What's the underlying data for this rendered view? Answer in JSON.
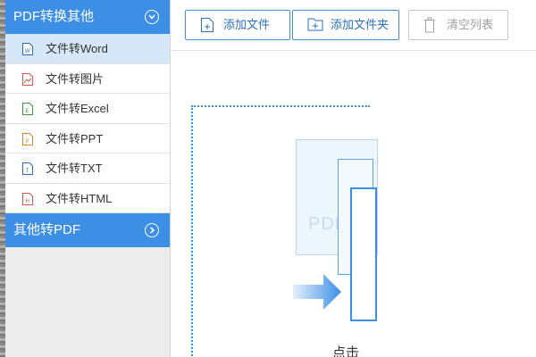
{
  "sidebar": {
    "section1_title": "PDF转换其他",
    "items": [
      {
        "label": "文件转Word",
        "icon": "word-file-icon",
        "color": "#2a6fbf"
      },
      {
        "label": "文件转图片",
        "icon": "image-file-icon",
        "color": "#d9534f"
      },
      {
        "label": "文件转Excel",
        "icon": "excel-file-icon",
        "color": "#3c9a3c"
      },
      {
        "label": "文件转PPT",
        "icon": "ppt-file-icon",
        "color": "#d98a2b"
      },
      {
        "label": "文件转TXT",
        "icon": "txt-file-icon",
        "color": "#2a6fbf"
      },
      {
        "label": "文件转HTML",
        "icon": "html-file-icon",
        "color": "#d9534f"
      }
    ],
    "section2_title": "其他转PDF"
  },
  "toolbar": {
    "add_file": "添加文件",
    "add_folder": "添加文件夹",
    "clear_list": "清空列表"
  },
  "dropzone": {
    "pdf_label": "PDF",
    "hint": "点击"
  },
  "colors": {
    "accent": "#3d8fe6",
    "active_item_bg": "#d6e8f8"
  }
}
